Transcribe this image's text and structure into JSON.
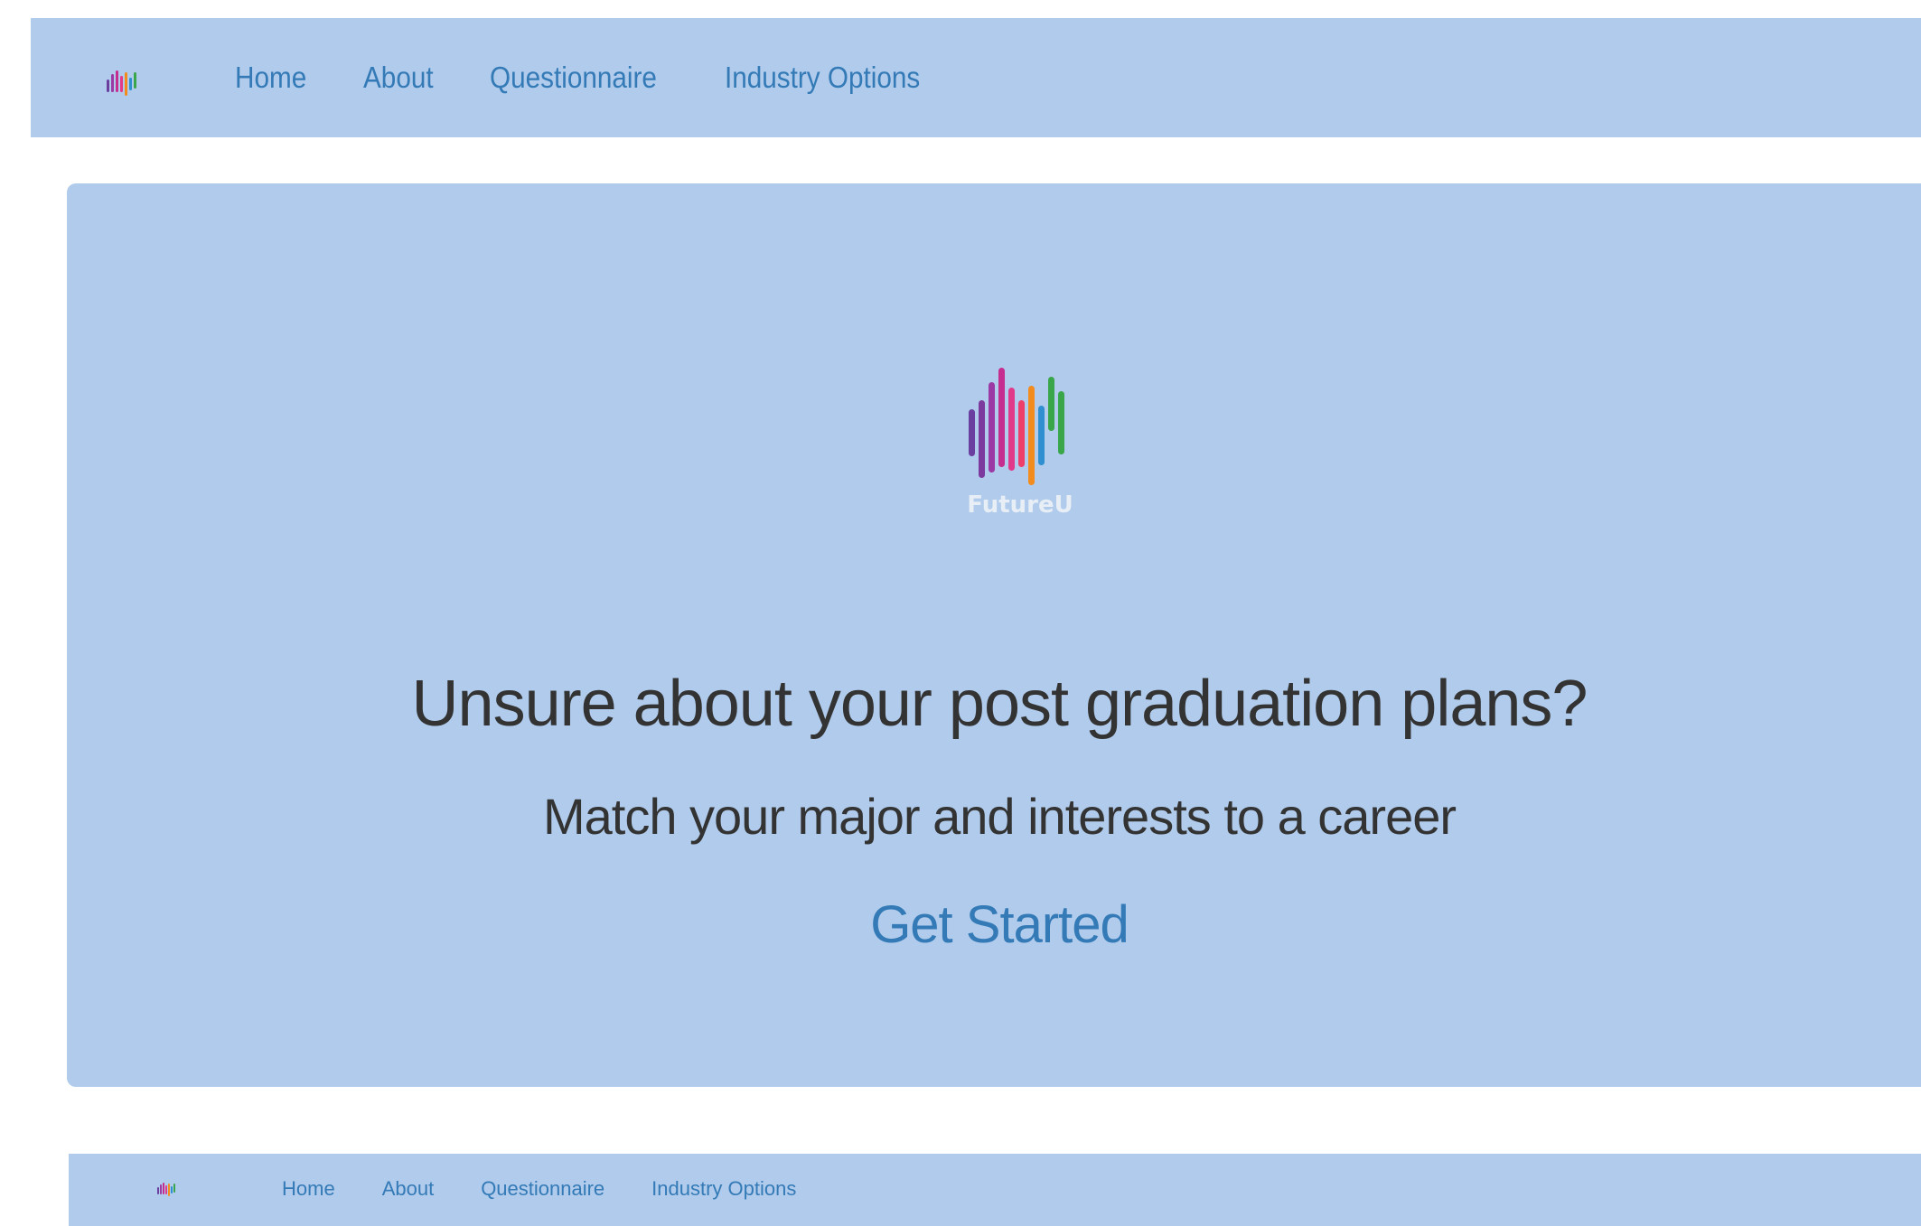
{
  "navbar": {
    "logo": "futureu-logo-icon",
    "links": [
      {
        "label": "Home"
      },
      {
        "label": "About"
      },
      {
        "label": "Questionnaire"
      },
      {
        "label": "Industry Options"
      }
    ]
  },
  "hero": {
    "logo_text": "FutureU",
    "title": "Unsure about your post graduation plans?",
    "subtitle": "Match your major and interests to a career",
    "cta": "Get Started"
  },
  "footer_navbar": {
    "logo": "futureu-logo-icon",
    "links": [
      {
        "label": "Home"
      },
      {
        "label": "About"
      },
      {
        "label": "Questionnaire"
      },
      {
        "label": "Industry Options"
      }
    ]
  },
  "colors": {
    "banner_bg": "#b0cbeb",
    "link": "#337ab7",
    "heading": "#333333",
    "logo_bars": [
      "#6a3fa0",
      "#9b3aa4",
      "#c52d8f",
      "#e23a8a",
      "#f28c1e",
      "#2f8fd0",
      "#3aa64a"
    ]
  }
}
